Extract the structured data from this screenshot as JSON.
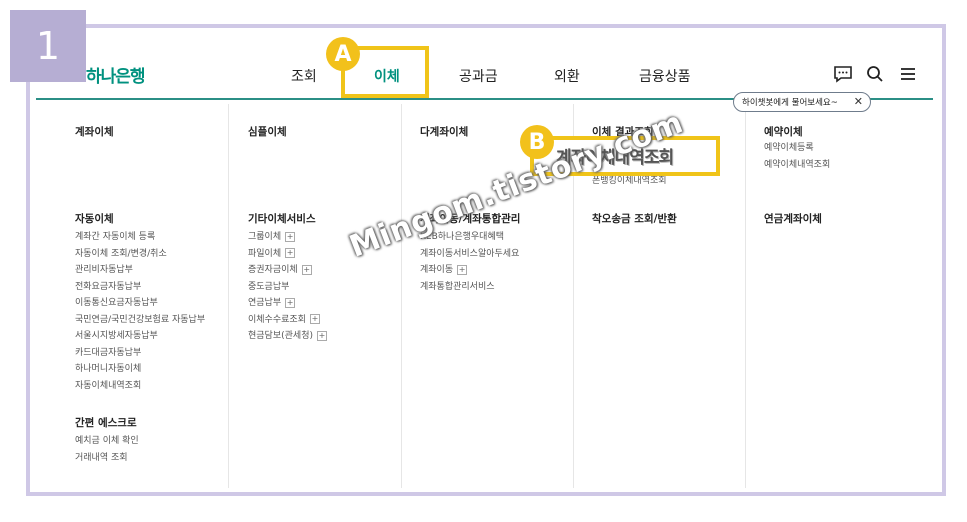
{
  "step_badge": "1",
  "logo": "하나은행",
  "nav": {
    "items": [
      "조회",
      "이체",
      "공과금",
      "외환",
      "금융상품"
    ],
    "active": "이체"
  },
  "tooltip": {
    "text": "하이챗봇에게 물어보세요~",
    "close": "✕"
  },
  "icons": {
    "chat": "chat-icon",
    "search": "search-icon",
    "menu": "hamburger-menu-icon"
  },
  "colors": {
    "accent": "#00917f",
    "highlight": "#f0c419",
    "badge": "#b6aed3"
  },
  "menu": {
    "col1": {
      "s1_title": "계좌이체",
      "s2_title": "자동이체",
      "s2_links": [
        "계좌간 자동이체 등록",
        "자동이체 조회/변경/취소",
        "관리비자동납부",
        "전화요금자동납부",
        "이동통신요금자동납부",
        "국민연금/국민건강보험료 자동납부",
        "서울시지방세자동납부",
        "카드대금자동납부",
        "하나머니자동이체",
        "자동이체내역조회"
      ],
      "s3_title": "간편 에스크로",
      "s3_links": [
        "예치금 이체 확인",
        "거래내역 조회"
      ]
    },
    "col2": {
      "s1_title": "심플이체",
      "s2_title": "기타이체서비스",
      "s2_links": [
        "그룹이체",
        "파일이체",
        "증권자금이체",
        "중도금납부",
        "연금납부",
        "이체수수료조회",
        "현금담보(관세청)"
      ]
    },
    "col3": {
      "s1_title": "다계좌이체",
      "s2_title": "계좌이동/계좌통합관리",
      "s2_links": [
        "KEB하나은행우대혜택",
        "계좌이동서비스알아두세요",
        "계좌이동",
        "계좌통합관리서비스"
      ]
    },
    "col4": {
      "s1_title": "이체 결과조회",
      "s1_links": [
        "폰뱅킹이체내역조회"
      ],
      "s2_title": "착오송금 조회/반환"
    },
    "col5": {
      "s1_title": "예약이체",
      "s1_links": [
        "예약이체등록",
        "예약이체내역조회"
      ],
      "s2_title": "연금계좌이체"
    }
  },
  "annotations": {
    "a_label": "A",
    "b_label": "B",
    "zoom_text": "계좌이체내역조회"
  },
  "watermark": "Mingom.tistory.com"
}
